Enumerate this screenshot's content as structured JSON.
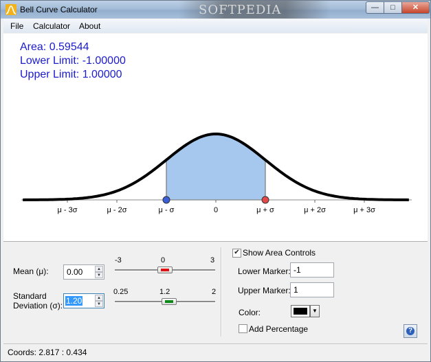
{
  "window": {
    "title": "Bell Curve Calculator",
    "watermark": "SOFTPEDIA"
  },
  "menu": [
    "File",
    "Calculator",
    "About"
  ],
  "readout": {
    "area": "Area: 0.59544",
    "lower": "Lower Limit: -1.00000",
    "upper": "Upper Limit: 1.00000"
  },
  "axis_labels": [
    "μ - 3σ",
    "μ - 2σ",
    "μ - σ",
    "0",
    "μ + σ",
    "μ + 2σ",
    "μ + 3σ"
  ],
  "colors": {
    "fill": "#a6c8ef",
    "readout": "#1b1bcc",
    "lower_marker": "#3a5fd9",
    "upper_marker": "#e24a4a",
    "area_color": "#000000"
  },
  "mean": {
    "label": "Mean (μ):",
    "value": "0.00",
    "slider": {
      "min_label": "-3",
      "mid_label": "0",
      "max_label": "3",
      "min": -3,
      "max": 3,
      "value": 0,
      "thumb_color": "#e01010"
    }
  },
  "std": {
    "label_line1": "Standard",
    "label_line2": "Deviation (σ):",
    "value": "1.20",
    "slider": {
      "min_label": "0.25",
      "mid_label": "1.2",
      "max_label": "2",
      "min": 0.25,
      "max": 2,
      "value": 1.2,
      "thumb_color": "#0b8a1a"
    }
  },
  "area_controls": {
    "show_label": "Show Area Controls",
    "show_checked": true,
    "lower_label": "Lower Marker:",
    "lower_value": "-1",
    "upper_label": "Upper Marker:",
    "upper_value": "1",
    "color_label": "Color:",
    "percent_label": "Add Percentage",
    "percent_checked": false
  },
  "icons": {
    "app": "bell-curve-app-icon",
    "help": "help-icon",
    "minimize": "minimize-icon",
    "maximize": "maximize-icon",
    "close": "close-icon"
  },
  "status": {
    "coords": "Coords: 2.817 : 0.434"
  }
}
